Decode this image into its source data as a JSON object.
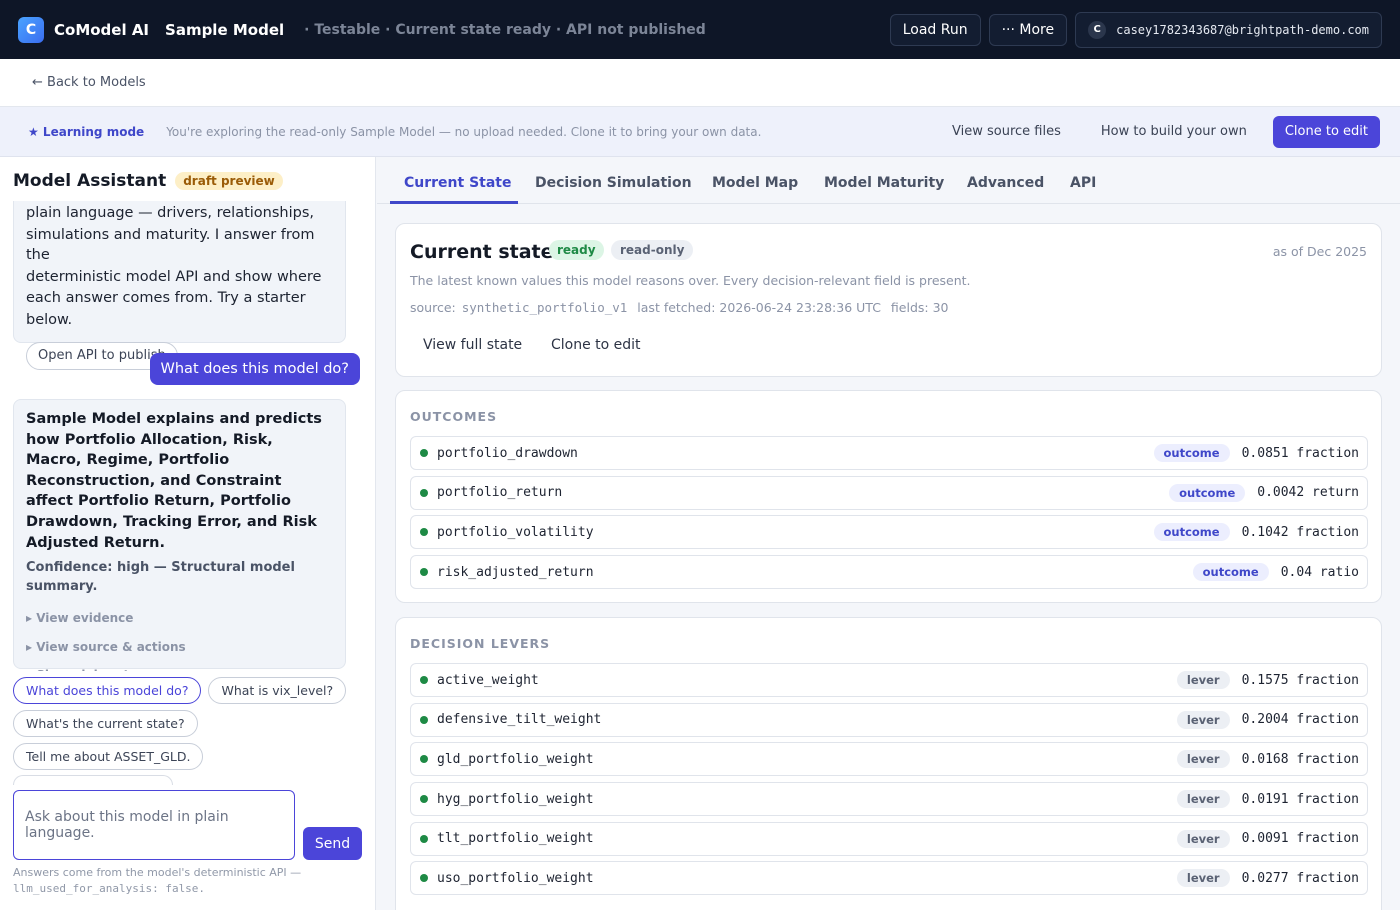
{
  "topbar": {
    "logo_letter": "C",
    "brand": "CoModel AI",
    "model_name": "Sample Model",
    "status_line": "· Testable · Current state ready · API not published",
    "load_run": "Load Run",
    "more": "··· More",
    "user_initial": "C",
    "user_email": "casey1782343687@brightpath-demo.com"
  },
  "back": {
    "label": "← Back to Models"
  },
  "banner": {
    "mode": "★ Learning mode",
    "text": "You're exploring the read-only Sample Model — no upload needed. Clone it to bring your own data.",
    "view_source": "View source files",
    "how_to": "How to build your own",
    "clone": "Clone to edit"
  },
  "assistant": {
    "title": "Model Assistant",
    "badge": "draft preview",
    "intro_lines": [
      "plain language — drivers, relationships,",
      "simulations and maturity. I answer from the",
      "deterministic model API and show where",
      "each answer comes from. Try a starter",
      "below."
    ],
    "intro_pill": "Open API to publish",
    "user_question": "What does this model do?",
    "answer": "Sample Model explains and predicts how Portfolio Allocation, Risk, Macro, Regime, Portfolio Reconstruction, and Constraint affect Portfolio Return, Portfolio Drawdown, Tracking Error, and Risk Adjusted Return.",
    "confidence": "Confidence: high — Structural model summary.",
    "disclosures": [
      "▸ View evidence",
      "▸ View source & actions",
      "▸ Show debug trace"
    ],
    "starters": [
      "What does this model do?",
      "What is vix_level?",
      "What's the current state?",
      "Tell me about ASSET_GLD."
    ],
    "input_placeholder": "Ask about this model in plain language.",
    "send": "Send",
    "footnote_text": "Answers come from the model's deterministic API —",
    "footnote_code": "llm_used_for_analysis: false."
  },
  "tabs": [
    "Current State",
    "Decision Simulation",
    "Model Map",
    "Model Maturity",
    "Advanced",
    "API"
  ],
  "current_state": {
    "title": "Current state",
    "badge_ready": "ready",
    "badge_readonly": "read-only",
    "as_of": "as of Dec 2025",
    "description": "The latest known values this model reasons over. Every decision-relevant field is present.",
    "source_label": "source:",
    "source_value": "synthetic_portfolio_v1",
    "fetched": "last fetched: 2026-06-24 23:28:36 UTC",
    "fields": "fields: 30",
    "view_full": "View full state",
    "clone": "Clone to edit"
  },
  "outcomes": {
    "label": "OUTCOMES",
    "rows": [
      {
        "name": "portfolio_drawdown",
        "kind": "outcome",
        "value": "0.0851 fraction"
      },
      {
        "name": "portfolio_return",
        "kind": "outcome",
        "value": "0.0042 return"
      },
      {
        "name": "portfolio_volatility",
        "kind": "outcome",
        "value": "0.1042 fraction"
      },
      {
        "name": "risk_adjusted_return",
        "kind": "outcome",
        "value": "0.04 ratio"
      }
    ]
  },
  "levers": {
    "label": "DECISION LEVERS",
    "rows": [
      {
        "name": "active_weight",
        "kind": "lever",
        "value": "0.1575 fraction"
      },
      {
        "name": "defensive_tilt_weight",
        "kind": "lever",
        "value": "0.2004 fraction"
      },
      {
        "name": "gld_portfolio_weight",
        "kind": "lever",
        "value": "0.0168 fraction"
      },
      {
        "name": "hyg_portfolio_weight",
        "kind": "lever",
        "value": "0.0191 fraction"
      },
      {
        "name": "tlt_portfolio_weight",
        "kind": "lever",
        "value": "0.0091 fraction"
      },
      {
        "name": "uso_portfolio_weight",
        "kind": "lever",
        "value": "0.0277 fraction"
      }
    ]
  },
  "colors": {
    "accent": "#4b45d9",
    "topbar": "#0e1627",
    "ready": "#1e8a45"
  }
}
